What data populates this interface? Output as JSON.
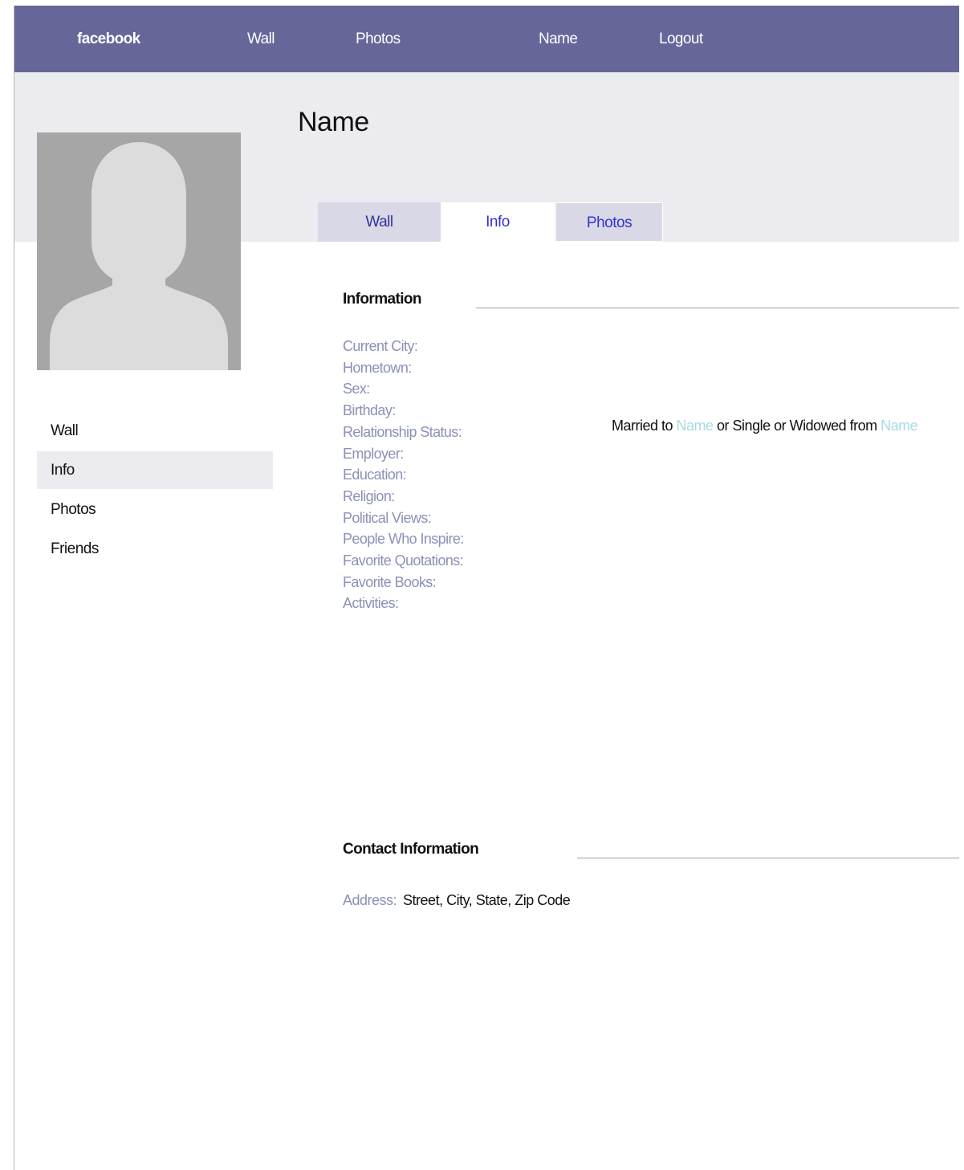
{
  "colors": {
    "topbar_bg": "#666699",
    "header_band_bg": "#ebebf0",
    "tab_inactive_bg": "#d8d8e6",
    "tab_text": "#3333cc",
    "field_label": "#8b91b8",
    "link_name": "#a8dce0",
    "avatar_bg": "#a6a6a6"
  },
  "topbar": {
    "brand": "facebook",
    "items": [
      "Wall",
      "Photos",
      "Name",
      "Logout"
    ]
  },
  "profile": {
    "name": "Name",
    "avatar_icon": "default-profile-silhouette-icon"
  },
  "tabs": [
    {
      "label": "Wall",
      "active": false
    },
    {
      "label": "Info",
      "active": true
    },
    {
      "label": "Photos",
      "active": false
    }
  ],
  "sidebar": {
    "items": [
      {
        "label": "Wall",
        "active": false
      },
      {
        "label": "Info",
        "active": true
      },
      {
        "label": "Photos",
        "active": false
      },
      {
        "label": "Friends",
        "active": false
      }
    ]
  },
  "information": {
    "title": "Information",
    "fields": [
      "Current City:",
      "Hometown:",
      "Sex:",
      "Birthday:",
      "Relationship Status:",
      "Employer:",
      "Education:",
      "Religion:",
      "Political Views:",
      "People Who Inspire:",
      "Favorite Quotations:",
      "Favorite Books:",
      "Activities:"
    ],
    "relationship_value": {
      "part1": "Married to ",
      "link1": "Name",
      "part2": " or Single or Widowed from ",
      "link2": "Name"
    }
  },
  "contact": {
    "title": "Contact Information",
    "address_label": "Address:",
    "address_value": "Street, City, State, Zip Code"
  }
}
